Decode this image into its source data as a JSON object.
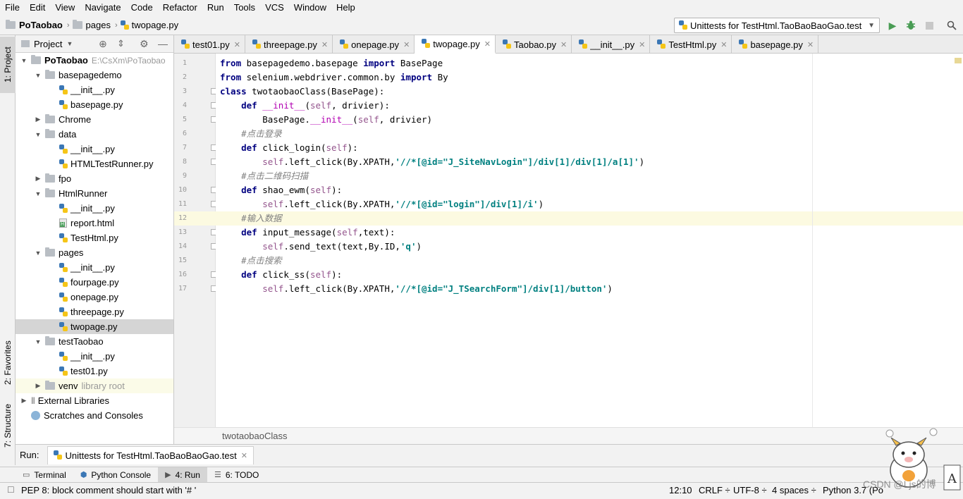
{
  "menu": [
    "File",
    "Edit",
    "View",
    "Navigate",
    "Code",
    "Refactor",
    "Run",
    "Tools",
    "VCS",
    "Window",
    "Help"
  ],
  "navbar": {
    "project": "PoTaobao",
    "folder": "pages",
    "file": "twopage.py",
    "run_config": "Unittests for TestHtml.TaoBaoBaoGao.test"
  },
  "left_stripe": {
    "project_tab": "1: Project",
    "favorites_tab": "2: Favorites",
    "structure_tab": "7: Structure"
  },
  "project_panel": {
    "title": "Project",
    "tree": [
      {
        "label": "PoTaobao",
        "extra": "E:\\CsXm\\PoTaobao",
        "type": "root"
      },
      {
        "label": "basepagedemo",
        "type": "folder-open"
      },
      {
        "label": "__init__.py",
        "type": "file"
      },
      {
        "label": "basepage.py",
        "type": "file"
      },
      {
        "label": "Chrome",
        "type": "folder-closed"
      },
      {
        "label": "data",
        "type": "folder-open"
      },
      {
        "label": "__init__.py",
        "type": "file"
      },
      {
        "label": "HTMLTestRunner.py",
        "type": "file"
      },
      {
        "label": "fpo",
        "type": "folder-closed"
      },
      {
        "label": "HtmlRunner",
        "type": "folder-open"
      },
      {
        "label": "__init__.py",
        "type": "file"
      },
      {
        "label": "report.html",
        "type": "html"
      },
      {
        "label": "TestHtml.py",
        "type": "file"
      },
      {
        "label": "pages",
        "type": "folder-open"
      },
      {
        "label": "__init__.py",
        "type": "file"
      },
      {
        "label": "fourpage.py",
        "type": "file"
      },
      {
        "label": "onepage.py",
        "type": "file"
      },
      {
        "label": "threepage.py",
        "type": "file"
      },
      {
        "label": "twopage.py",
        "type": "file",
        "selected": true
      },
      {
        "label": "testTaobao",
        "type": "folder-open"
      },
      {
        "label": "__init__.py",
        "type": "file"
      },
      {
        "label": "test01.py",
        "type": "file"
      },
      {
        "label": "venv",
        "extra": "library root",
        "type": "folder-closed"
      },
      {
        "label": "External Libraries",
        "type": "libs"
      },
      {
        "label": "Scratches and Consoles",
        "type": "scratch"
      }
    ]
  },
  "editor_tabs": [
    {
      "label": "test01.py"
    },
    {
      "label": "threepage.py"
    },
    {
      "label": "onepage.py"
    },
    {
      "label": "twopage.py",
      "active": true
    },
    {
      "label": "Taobao.py"
    },
    {
      "label": "__init__.py"
    },
    {
      "label": "TestHtml.py"
    },
    {
      "label": "basepage.py"
    }
  ],
  "line_numbers": [
    "1",
    "2",
    "3",
    "4",
    "5",
    "6",
    "7",
    "8",
    "9",
    "10",
    "11",
    "12",
    "13",
    "14",
    "15",
    "16",
    "17"
  ],
  "code_lines": [
    [
      [
        "kw",
        "from"
      ],
      [
        "dflt",
        " basepagedemo.basepage "
      ],
      [
        "kw",
        "import"
      ],
      [
        "dflt",
        " BasePage"
      ]
    ],
    [
      [
        "kw",
        "from"
      ],
      [
        "dflt",
        " selenium.webdriver.common.by "
      ],
      [
        "kw",
        "import"
      ],
      [
        "dflt",
        " By"
      ]
    ],
    [
      [
        "kw",
        "class"
      ],
      [
        "dflt",
        " twotaobaoClass(BasePage):"
      ]
    ],
    [
      [
        "dflt",
        "    "
      ],
      [
        "kw",
        "def"
      ],
      [
        "dflt",
        " "
      ],
      [
        "magic",
        "__init__"
      ],
      [
        "dflt",
        "("
      ],
      [
        "slf",
        "self"
      ],
      [
        "dflt",
        ", drivier):"
      ]
    ],
    [
      [
        "dflt",
        "        BasePage."
      ],
      [
        "magic",
        "__init__"
      ],
      [
        "dflt",
        "("
      ],
      [
        "slf",
        "self"
      ],
      [
        "dflt",
        ", drivier)"
      ]
    ],
    [
      [
        "dflt",
        "    "
      ],
      [
        "cmt",
        "#点击登录"
      ]
    ],
    [
      [
        "dflt",
        "    "
      ],
      [
        "kw",
        "def"
      ],
      [
        "dflt",
        " click_login("
      ],
      [
        "slf",
        "self"
      ],
      [
        "dflt",
        "):"
      ]
    ],
    [
      [
        "dflt",
        "        "
      ],
      [
        "slf",
        "self"
      ],
      [
        "dflt",
        ".left_click(By.XPATH,"
      ],
      [
        "str",
        "'//*[@id=\"J_SiteNavLogin\"]/div[1]/div[1]/a[1]'"
      ],
      [
        "dflt",
        ")"
      ]
    ],
    [
      [
        "dflt",
        "    "
      ],
      [
        "cmt",
        "#点击二维码扫描"
      ]
    ],
    [
      [
        "dflt",
        "    "
      ],
      [
        "kw",
        "def"
      ],
      [
        "dflt",
        " shao_ewm("
      ],
      [
        "slf",
        "self"
      ],
      [
        "dflt",
        "):"
      ]
    ],
    [
      [
        "dflt",
        "        "
      ],
      [
        "slf",
        "self"
      ],
      [
        "dflt",
        ".left_click(By.XPATH,"
      ],
      [
        "str",
        "'//*[@id=\"login\"]/div[1]/i'"
      ],
      [
        "dflt",
        ")"
      ]
    ],
    [
      [
        "dflt",
        "    "
      ],
      [
        "cmt",
        "#输入数据"
      ]
    ],
    [
      [
        "dflt",
        "    "
      ],
      [
        "kw",
        "def"
      ],
      [
        "dflt",
        " input_message("
      ],
      [
        "slf",
        "self"
      ],
      [
        "dflt",
        ",text):"
      ]
    ],
    [
      [
        "dflt",
        "        "
      ],
      [
        "slf",
        "self"
      ],
      [
        "dflt",
        ".send_text(text,By.ID,"
      ],
      [
        "str",
        "'q'"
      ],
      [
        "dflt",
        ")"
      ]
    ],
    [
      [
        "dflt",
        "    "
      ],
      [
        "cmt",
        "#点击搜索"
      ]
    ],
    [
      [
        "dflt",
        "    "
      ],
      [
        "kw",
        "def"
      ],
      [
        "dflt",
        " click_ss("
      ],
      [
        "slf",
        "self"
      ],
      [
        "dflt",
        "):"
      ]
    ],
    [
      [
        "dflt",
        "        "
      ],
      [
        "slf",
        "self"
      ],
      [
        "dflt",
        ".left_click(By.XPATH,"
      ],
      [
        "str",
        "'//*[@id=\"J_TSearchForm\"]/div[1]/button'"
      ],
      [
        "dflt",
        ")"
      ]
    ]
  ],
  "editor_breadcrumb": "twotaobaoClass",
  "run_panel": {
    "label": "Run:",
    "tab": "Unittests for TestHtml.TaoBaoBaoGao.test"
  },
  "bottom_tools": [
    {
      "label": "Terminal"
    },
    {
      "label": "Python Console"
    },
    {
      "label": "4: Run",
      "active": true
    },
    {
      "label": "6: TODO"
    }
  ],
  "status": {
    "message": "PEP 8: block comment should start with '# '",
    "position": "12:10",
    "line_sep": "CRLF ÷",
    "encoding": "UTF-8 ÷",
    "indent": "4 spaces ÷",
    "interpreter": "Python 3.7 (Po",
    "watermark": "CSDN @Ljs的博"
  },
  "colors": {
    "keyword": "#000080",
    "self": "#94558d",
    "string": "#008080",
    "comment": "#808080",
    "magic": "#b200b2",
    "current_line": "#fcfae1",
    "run_green": "#499c54"
  }
}
